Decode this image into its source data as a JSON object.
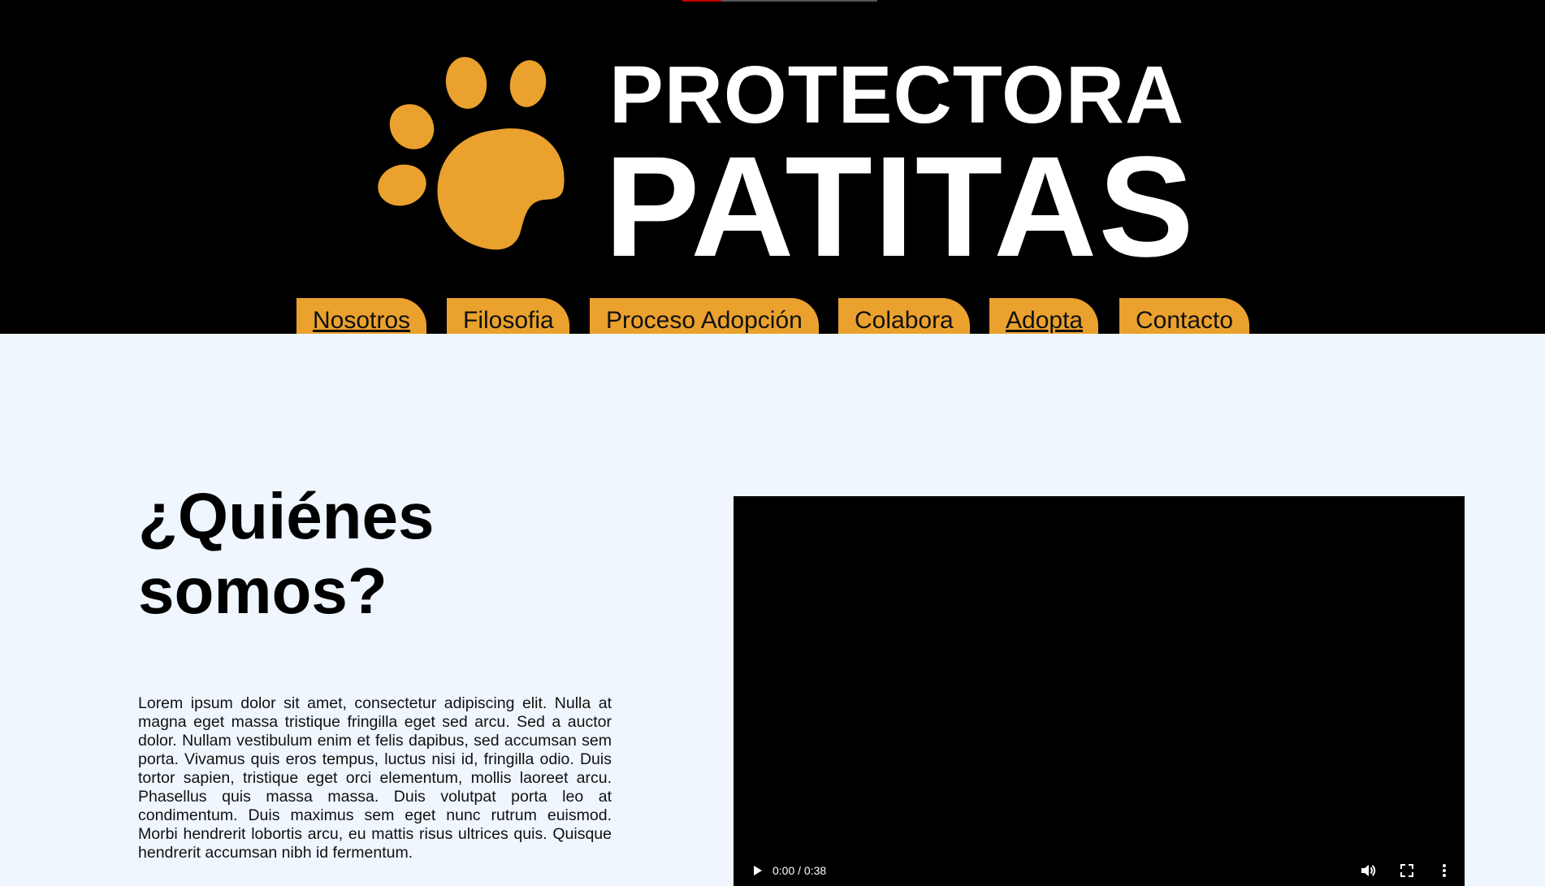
{
  "brand": {
    "line1": "PROTECTORA",
    "line2": "PATITAS",
    "accent_color": "#eaa12d",
    "logo_icon": "paw-icon"
  },
  "nav": {
    "items": [
      {
        "label": "Nosotros",
        "underlined": true
      },
      {
        "label": "Filosofia",
        "underlined": false
      },
      {
        "label": "Proceso Adopción",
        "underlined": false
      },
      {
        "label": "Colabora",
        "underlined": false
      },
      {
        "label": "Adopta",
        "underlined": true
      },
      {
        "label": "Contacto",
        "underlined": false
      }
    ]
  },
  "main": {
    "title": "¿Quiénes somos?",
    "body": "Lorem ipsum dolor sit amet, consectetur adipiscing elit. Nulla at magna eget massa tristique fringilla eget sed arcu. Sed a auctor dolor. Nullam vestibulum enim et felis dapibus, sed accumsan sem porta. Vivamus quis eros tempus, luctus nisi id, fringilla odio. Duis tortor sapien, tristique eget orci elementum, mollis laoreet arcu. Phasellus quis massa massa. Duis volutpat porta leo at condimentum. Duis maximus sem eget nunc rutrum euismod. Morbi hendrerit lobortis arcu, eu mattis risus ultrices quis. Quisque hendrerit accumsan nibh id fermentum."
  },
  "video": {
    "time": "0:00 / 0:38",
    "controls": [
      "play-icon",
      "volume-icon",
      "fullscreen-icon",
      "more-options-icon"
    ]
  },
  "colors": {
    "header_bg": "#000000",
    "page_bg": "#eff6fe",
    "tab_bg": "#eaa12d"
  }
}
